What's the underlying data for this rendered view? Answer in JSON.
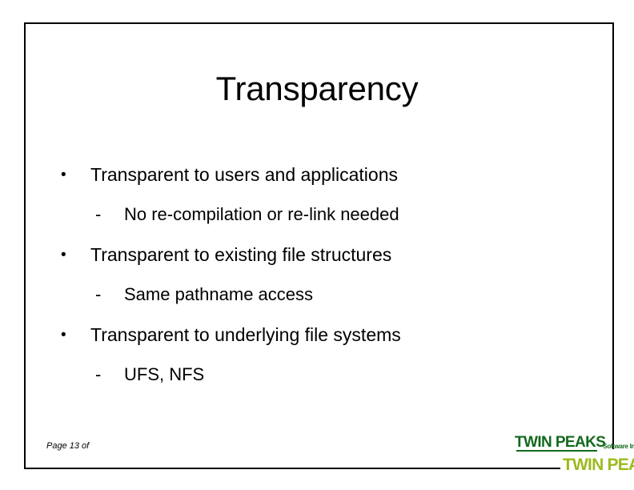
{
  "slide": {
    "title": "Transparency",
    "bullets": [
      {
        "level": 1,
        "marker": "•",
        "text": "Transparent to users and applications"
      },
      {
        "level": 2,
        "marker": "-",
        "text": "No re-compilation or re-link needed"
      },
      {
        "level": 1,
        "marker": "•",
        "text": "Transparent to existing file structures"
      },
      {
        "level": 2,
        "marker": "-",
        "text": "Same pathname access"
      },
      {
        "level": 1,
        "marker": "•",
        "text": "Transparent to underlying file systems"
      },
      {
        "level": 2,
        "marker": "-",
        "text": "UFS, NFS"
      }
    ],
    "footer": {
      "page_label": "Page 13 of"
    },
    "logos": {
      "primary": {
        "name": "TWIN PEAKS",
        "tagline": "Software Inc.",
        "color": "#12691d"
      },
      "secondary": {
        "name": "TWIN PEAKS",
        "color": "#9cba1f"
      }
    },
    "colors": {
      "background": "#ffffff",
      "text": "#000000",
      "border": "#000000"
    }
  }
}
